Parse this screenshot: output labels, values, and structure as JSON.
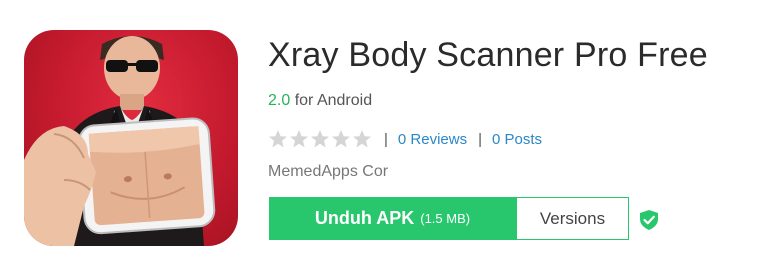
{
  "app": {
    "title": "Xray Body Scanner Pro Free",
    "version": "2.0",
    "platform_text": "for Android",
    "rating_stars_filled": 0,
    "rating_stars_total": 5,
    "reviews_label": "0 Reviews",
    "posts_label": "0 Posts",
    "developer": "MemedApps Cor",
    "icon_name": "xray-body-scanner-app-icon"
  },
  "actions": {
    "download_label": "Unduh APK",
    "download_size": "(1.5 MB)",
    "versions_label": "Versions",
    "verified_icon": "shield-check-icon"
  },
  "separators": {
    "bar": "|"
  },
  "colors": {
    "accent_green": "#29c76d",
    "version_green": "#27b35a",
    "link_blue": "#2a87c8",
    "icon_background_red": "#c41a2e",
    "star_empty": "#d5d5d5"
  }
}
